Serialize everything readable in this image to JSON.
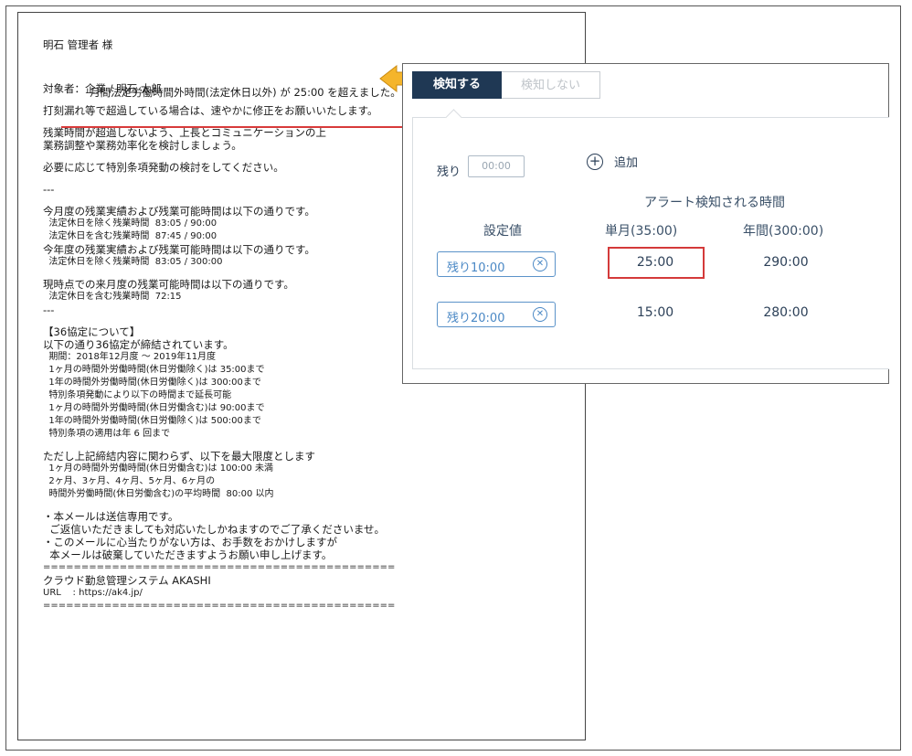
{
  "mail": {
    "greeting": "明石 管理者 様",
    "headline": "月間法定労働時間外時間(法定休日以外) が 25:00 を超えました。",
    "target": "対象者：企業 / 明石 太郎",
    "lines": [
      "打刻漏れ等で超過している場合は、速やかに修正をお願いいたします。",
      "残業時間が超過しないよう、上長とコミュニケーションの上",
      "業務調整や業務効率化を検討しましょう。",
      "必要に応じて特別条項発動の検討をしてください。",
      "---",
      "今月度の残業実績および残業可能時間は以下の通りです。",
      "  法定休日を除く残業時間  83:05 / 90:00",
      "  法定休日を含む残業時間  87:45 / 90:00",
      "今年度の残業実績および残業可能時間は以下の通りです。",
      "  法定休日を除く残業時間  83:05 / 300:00",
      "現時点での来月度の残業可能時間は以下の通りです。",
      "  法定休日を含む残業時間  72:15",
      "---",
      "【36協定について】",
      "以下の通り36協定が締結されています。",
      "  期間：2018年12月度 ～ 2019年11月度",
      "  1ヶ月の時間外労働時間(休日労働除く)は 35:00まで",
      "  1年の時間外労働時間(休日労働除く)は 300:00まで",
      "  特別条項発動により以下の時間まで延長可能",
      "  1ヶ月の時間外労働時間(休日労働含む)は 90:00まで",
      "  1年の時間外労働時間(休日労働除く)は 500:00まで",
      "  特別条項の適用は年 6 回まで",
      "ただし上記締結内容に関わらず、以下を最大限度とします",
      "  1ヶ月の時間外労働時間(休日労働含む)は 100:00 未満",
      "  2ヶ月、3ヶ月、4ヶ月、5ヶ月、6ヶ月の",
      "  時間外労働時間(休日労働含む)の平均時間  80:00 以内",
      "・本メールは送信専用です。",
      "  ご返信いただきましても対応いたしかねますのでご了承くださいませ。",
      "・このメールに心当たりがない方は、お手数をおかけしますが",
      "  本メールは破棄していただきますようお願い申し上げます。",
      "==============================================",
      "クラウド勤怠管理システム AKASHI",
      "URL    : https://ak4.jp/",
      "=============================================="
    ]
  },
  "panel": {
    "tab_detect": "検知する",
    "tab_nodetect": "検知しない",
    "remain_label": "残り",
    "remain_placeholder": "00:00",
    "add_label": "追加",
    "alert_title": "アラート検知される時間",
    "col_setting": "設定値",
    "col_month": "単月(35:00)",
    "col_year": "年間(300:00)",
    "rows": [
      {
        "setting": "残り10:00",
        "month": "25:00",
        "year": "290:00"
      },
      {
        "setting": "残り20:00",
        "month": "15:00",
        "year": "280:00"
      }
    ]
  },
  "colors": {
    "tab_active": "#1f3854",
    "chip": "#4a88c5",
    "highlight": "#d43a3a",
    "arrow": "#f5b52b"
  }
}
